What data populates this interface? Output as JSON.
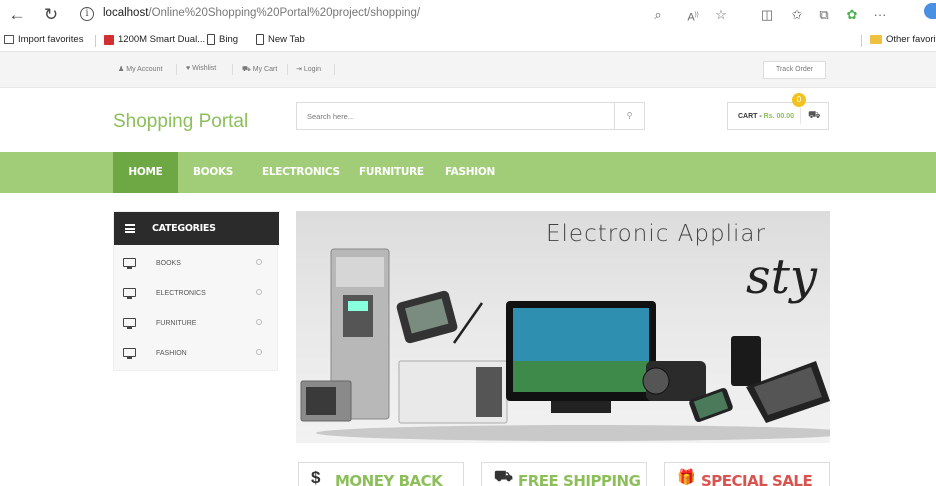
{
  "browser": {
    "url_host": "localhost",
    "url_path": "/Online%20Shopping%20Portal%20project/shopping/",
    "favorites": [
      {
        "label": "Import favorites",
        "icon": "import-icon"
      },
      {
        "label": "1200M Smart Dual...",
        "icon": "site-favicon"
      },
      {
        "label": "Bing",
        "icon": "page-icon"
      },
      {
        "label": "New Tab",
        "icon": "page-icon"
      }
    ],
    "other_favorites": "Other favorit",
    "toolbar_more": "···"
  },
  "top_bar": {
    "links": [
      "My Account",
      "Wishlist",
      "My Cart",
      "Login"
    ],
    "track_order": "Track Order"
  },
  "header": {
    "logo": "Shopping Portal",
    "search_placeholder": "Search here...",
    "cart_label": "CART - ",
    "cart_amount": "Rs. 00.00",
    "cart_count": "0"
  },
  "menu": {
    "items": [
      "HOME",
      "BOOKS",
      "ELECTRONICS",
      "FURNITURE",
      "FASHION"
    ],
    "active": "HOME"
  },
  "sidebar": {
    "title": "CATEGORIES",
    "items": [
      "BOOKS",
      "ELECTRONICS",
      "FURNITURE",
      "FASHION"
    ]
  },
  "hero": {
    "title": "Electronic Appliar",
    "script": "sty"
  },
  "features": [
    {
      "label": "MONEY BACK",
      "icon": "dollar-icon",
      "color": "#8cbf5a"
    },
    {
      "label": "FREE SHIPPING",
      "icon": "truck-icon",
      "color": "#8cbf5a"
    },
    {
      "label": "SPECIAL SALE",
      "icon": "gift-icon",
      "color": "#d9534f"
    }
  ],
  "colors": {
    "brand_green": "#8cbf5a",
    "menu_green": "#a2cd78",
    "menu_active": "#6ea844",
    "dark": "#2b2b2b"
  }
}
